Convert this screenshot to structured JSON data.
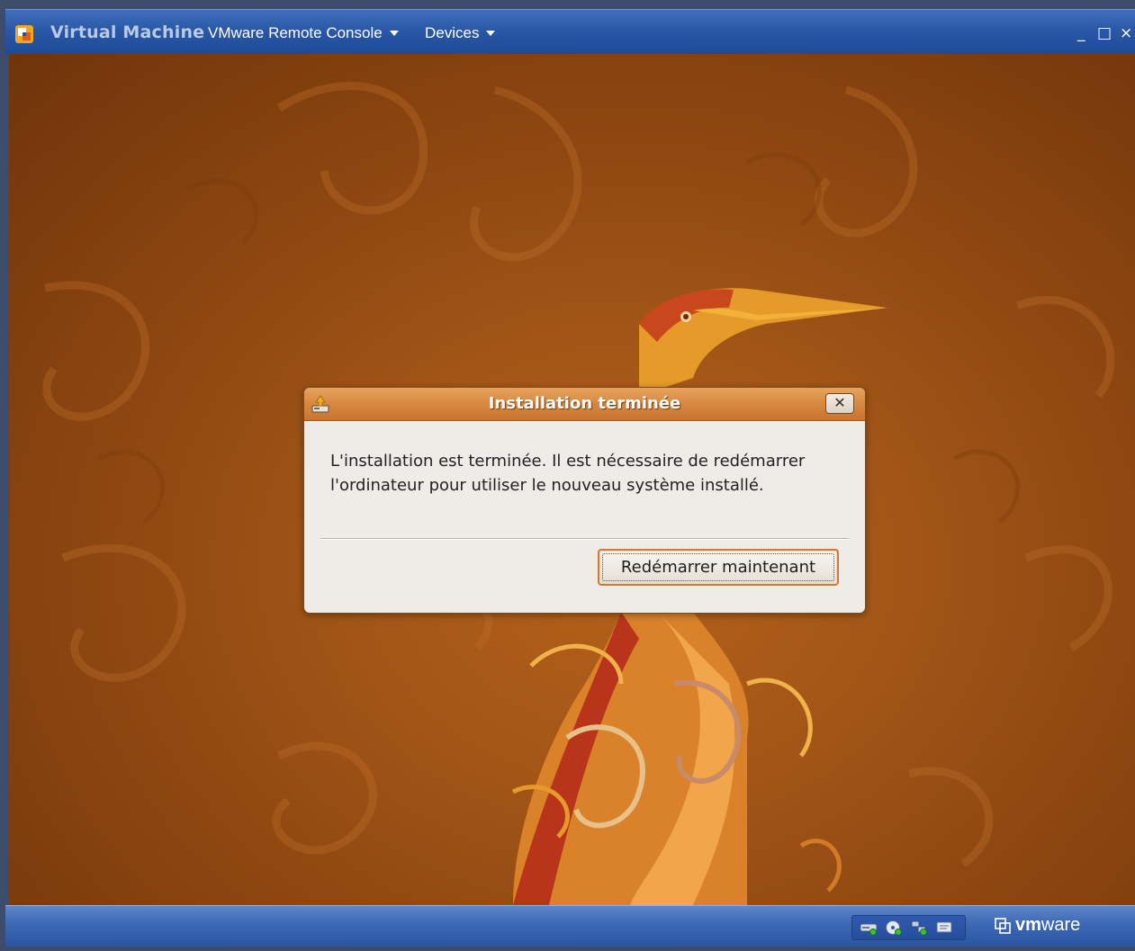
{
  "console": {
    "title": "Virtual Machine",
    "menus": [
      {
        "label": "VMware Remote Console"
      },
      {
        "label": "Devices"
      }
    ],
    "window_controls": {
      "minimize": "_",
      "maximize": "□",
      "close": "×"
    }
  },
  "dialog": {
    "title": "Installation terminée",
    "close_glyph": "✕",
    "message": "L'installation est terminée. Il est nécessaire de redémarrer l'ordinateur pour utiliser le nouveau système installé.",
    "button_label": "Redémarrer maintenant"
  },
  "statusbar": {
    "tray_icons": [
      "hard-disk-icon",
      "cd-rom-icon",
      "network-icon",
      "message-icon"
    ],
    "logo": {
      "vm": "vm",
      "ware": "ware"
    }
  },
  "colors": {
    "dialog_title_bar": "#d7883f",
    "desktop": "#a05416",
    "console_bar": "#2a58a6"
  }
}
